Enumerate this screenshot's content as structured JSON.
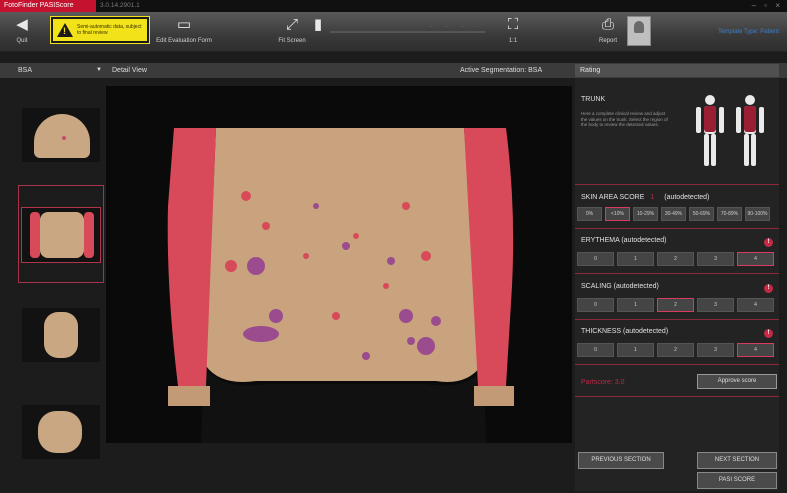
{
  "titlebar": {
    "app": "FotoFinder PASIScore",
    "version": "3.0.14.2901.1",
    "controls": "– ▫ ×"
  },
  "toolbar": {
    "quit_label": "Quit",
    "warning_text": "Semi-automatic data, subject to final review",
    "edit_evaluation_label": "Edit Evaluation Form",
    "fit_screen_label": "Fit Screen",
    "zoom_label": "1:1",
    "report_label": "Report",
    "patient_tag": "Template Type: Patient"
  },
  "header": {
    "mode": "BSA",
    "detail_title": "Detail View",
    "active_segmentation_label": "Active Segmentation:",
    "active_segmentation_value": "BSA",
    "rating_title": "Rating"
  },
  "rating": {
    "region": "TRUNK",
    "region_desc": "Here a complete clinical review and adjust the values on the trunk. Select the region of the body to review the detected values.",
    "skin_area": {
      "label": "SKIN AREA SCORE",
      "value": "1",
      "suffix": "(autodetected)",
      "options": [
        "0%",
        "<10%",
        "10-29%",
        "30-49%",
        "50-69%",
        "70-89%",
        "90-100%"
      ],
      "selected_index": 1
    },
    "erythema": {
      "label": "ERYTHEMA (autodetected)",
      "options": [
        "0",
        "1",
        "2",
        "3",
        "4"
      ],
      "selected_index": 4
    },
    "scaling": {
      "label": "SCALING (autodetected)",
      "options": [
        "0",
        "1",
        "2",
        "3",
        "4"
      ],
      "selected_index": 2
    },
    "thickness": {
      "label": "THICKNESS (autodetected)",
      "options": [
        "0",
        "1",
        "2",
        "3",
        "4"
      ],
      "selected_index": 4
    },
    "pasi_score": "Partscore: 3.0",
    "approve_label": "Approve score",
    "prev_label": "PREVIOUS SECTION",
    "next_label": "NEXT SECTION",
    "pasi_button": "PASI SCORE",
    "info_icon": "!"
  },
  "colors": {
    "accent": "#c4122f",
    "selected": "#d83b5e",
    "lesion": "#d84a5a",
    "lesion_dark": "#9a4c8e",
    "skin": "#c9a783"
  }
}
